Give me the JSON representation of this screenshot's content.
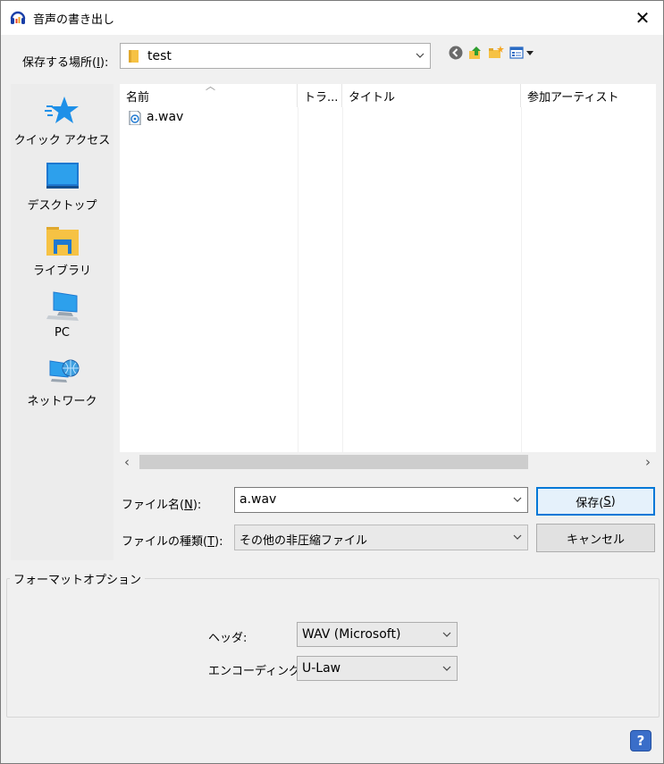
{
  "window": {
    "title": "音声の書き出し",
    "close_glyph": "✕",
    "app_icon": "headphones-icon"
  },
  "location": {
    "label_prefix": "保存する場所(",
    "label_key": "I",
    "label_suffix": "):",
    "value": "test",
    "toolbar_icons": [
      "back-icon",
      "up-folder-icon",
      "new-folder-icon",
      "view-menu-icon"
    ]
  },
  "places": [
    {
      "label": "クイック アクセス",
      "icon": "star-icon"
    },
    {
      "label": "デスクトップ",
      "icon": "desktop-icon"
    },
    {
      "label": "ライブラリ",
      "icon": "library-icon"
    },
    {
      "label": "PC",
      "icon": "pc-icon"
    },
    {
      "label": "ネットワーク",
      "icon": "network-icon"
    }
  ],
  "filelist": {
    "columns": [
      "名前",
      "トラ...",
      "タイトル",
      "参加アーティスト"
    ],
    "files": [
      {
        "name": "a.wav",
        "icon": "audio-file-icon"
      }
    ]
  },
  "filename": {
    "label_prefix": "ファイル名(",
    "label_key": "N",
    "label_suffix": "):",
    "value": "a.wav"
  },
  "filetype": {
    "label_prefix": "ファイルの種類(",
    "label_key": "T",
    "label_suffix": "):",
    "value": "その他の非圧縮ファイル"
  },
  "buttons": {
    "save_prefix": "保存(",
    "save_key": "S",
    "save_suffix": ")",
    "cancel": "キャンセル"
  },
  "format_options": {
    "title": "フォーマットオプション",
    "header_label": "ヘッダ:",
    "header_value": "WAV (Microsoft)",
    "encoding_label": "エンコーディング:",
    "encoding_value": "U-Law"
  },
  "help": {
    "glyph": "?"
  },
  "colors": {
    "accent": "#0078d7",
    "star": "#1e90e8",
    "folder": "#f6c244"
  }
}
